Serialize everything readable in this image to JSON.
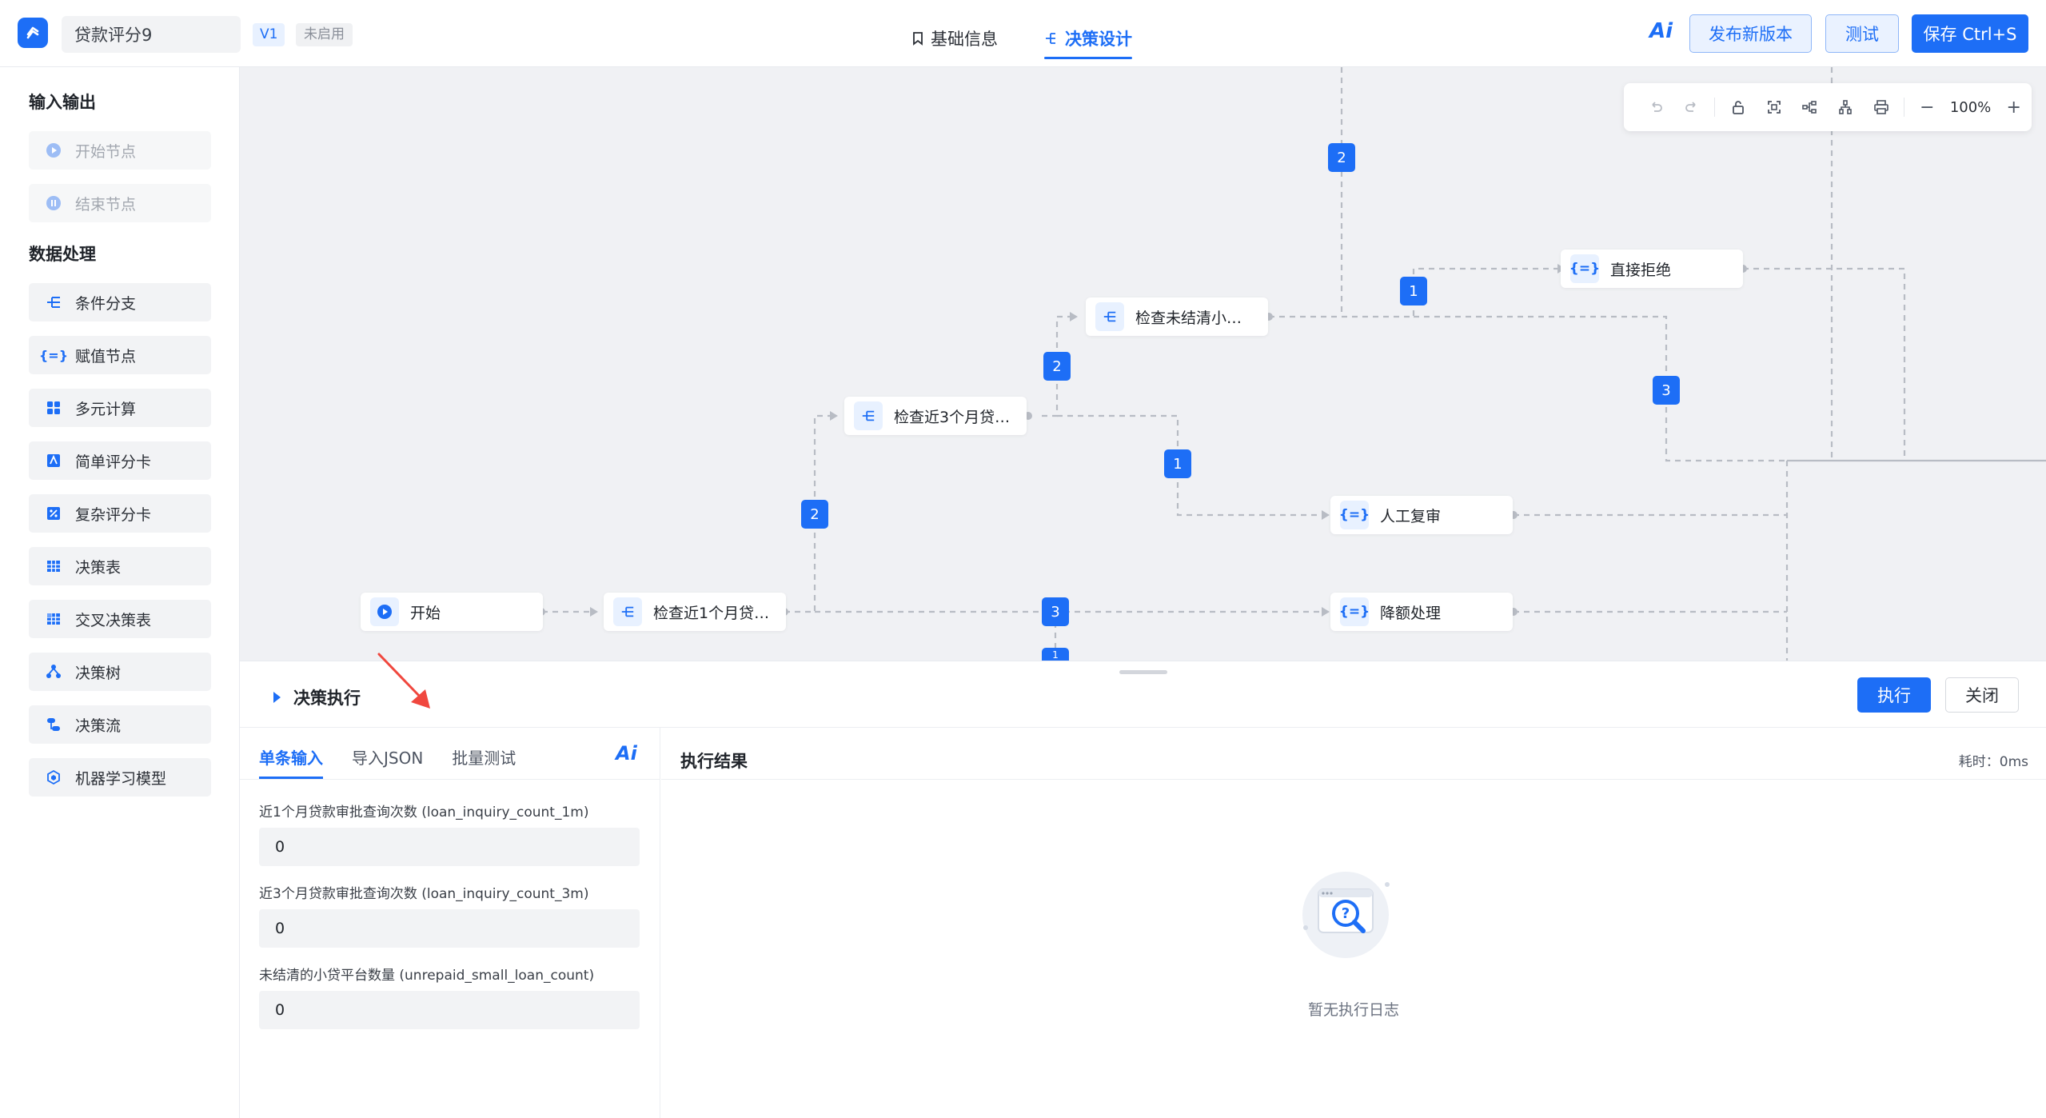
{
  "header": {
    "app_title": "贷款评分9",
    "version": "V1",
    "status": "未启用",
    "tabs": [
      {
        "label": "基础信息",
        "active": false
      },
      {
        "label": "决策设计",
        "active": true
      }
    ],
    "ai_label": "Ai",
    "publish_label": "发布新版本",
    "test_label": "测试",
    "save_label": "保存 Ctrl+S"
  },
  "sidebar": {
    "sections": [
      {
        "title": "输入输出",
        "items": [
          {
            "label": "开始节点",
            "icon": "play-circle-icon",
            "disabled": true
          },
          {
            "label": "结束节点",
            "icon": "pause-circle-icon",
            "disabled": true
          }
        ]
      },
      {
        "title": "数据处理",
        "items": [
          {
            "label": "条件分支",
            "icon": "branch-icon"
          },
          {
            "label": "赋值节点",
            "icon": "braces-icon"
          },
          {
            "label": "多元计算",
            "icon": "grid-calc-icon"
          },
          {
            "label": "简单评分卡",
            "icon": "scorecard-icon"
          },
          {
            "label": "复杂评分卡",
            "icon": "percent-card-icon"
          },
          {
            "label": "决策表",
            "icon": "table-icon"
          },
          {
            "label": "交叉决策表",
            "icon": "cross-table-icon"
          },
          {
            "label": "决策树",
            "icon": "tree-icon"
          },
          {
            "label": "决策流",
            "icon": "flow-icon"
          },
          {
            "label": "机器学习模型",
            "icon": "cube-icon"
          }
        ]
      }
    ]
  },
  "canvas": {
    "nodes": [
      {
        "label": "开始",
        "icon": "play-icon"
      },
      {
        "label": "检查近1个月贷…",
        "icon": "branch-icon"
      },
      {
        "label": "检查近3个月贷…",
        "icon": "branch-icon"
      },
      {
        "label": "检查未结清小…",
        "icon": "branch-icon"
      },
      {
        "label": "直接拒绝",
        "icon": "braces-icon"
      },
      {
        "label": "人工复审",
        "icon": "braces-icon"
      },
      {
        "label": "降额处理",
        "icon": "braces-icon"
      }
    ],
    "badges": [
      "2",
      "1",
      "2",
      "3",
      "1",
      "2",
      "3",
      "1"
    ],
    "zoom": "100%"
  },
  "panel": {
    "title": "决策执行",
    "run_label": "执行",
    "close_label": "关闭",
    "input_tabs": [
      {
        "label": "单条输入",
        "active": true
      },
      {
        "label": "导入JSON",
        "active": false
      },
      {
        "label": "批量测试",
        "active": false
      }
    ],
    "ai_label": "Ai",
    "fields": [
      {
        "label": "近1个月贷款审批查询次数 (loan_inquiry_count_1m)",
        "value": "0"
      },
      {
        "label": "近3个月贷款审批查询次数 (loan_inquiry_count_3m)",
        "value": "0"
      },
      {
        "label": "未结清的小贷平台数量 (unrepaid_small_loan_count)",
        "value": "0"
      }
    ],
    "result_title": "执行结果",
    "elapsed": "耗时：0ms",
    "empty_text": "暂无执行日志"
  },
  "colors": {
    "accent": "#1d6ef6",
    "canvas_bg": "#f0f1f4",
    "annotation_arrow": "#f0473e"
  }
}
